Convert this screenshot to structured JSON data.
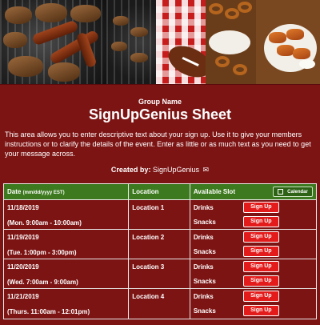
{
  "header": {
    "group_name": "Group Name",
    "title": "SignUpGenius Sheet",
    "description": "This area allows you to enter descriptive text about your sign up. Use it to give your members instructions or to clarify the details of the event. Enter as little or as much text as you need to get your message across.",
    "created_by_label": "Created by:",
    "created_by_name": "SignUpGenius",
    "mail_icon": "envelope-icon"
  },
  "table": {
    "columns": {
      "date": "Date",
      "date_format": "(mm/dd/yyyy EST)",
      "location": "Location",
      "slot": "Available Slot"
    },
    "calendar_button": "Calendar",
    "signup_label": "Sign Up",
    "rows": [
      {
        "date": "11/18/2019",
        "time": "(Mon. 9:00am - 10:00am)",
        "location": "Location 1",
        "slots": [
          "Drinks",
          "Snacks"
        ]
      },
      {
        "date": "11/19/2019",
        "time": "(Tue. 1:00pm - 3:00pm)",
        "location": "Location 2",
        "slots": [
          "Drinks",
          "Snacks"
        ]
      },
      {
        "date": "11/20/2019",
        "time": "(Wed. 7:00am - 9:00am)",
        "location": "Location 3",
        "slots": [
          "Drinks",
          "Snacks"
        ]
      },
      {
        "date": "11/21/2019",
        "time": "(Thurs. 11:00am - 12:01pm)",
        "location": "Location 4",
        "slots": [
          "Drinks",
          "Snacks"
        ]
      }
    ]
  },
  "colors": {
    "background": "#7d1414",
    "header_green": "#3d7a1f",
    "signup_red": "#e31b1b",
    "border": "#e8e8e8"
  }
}
